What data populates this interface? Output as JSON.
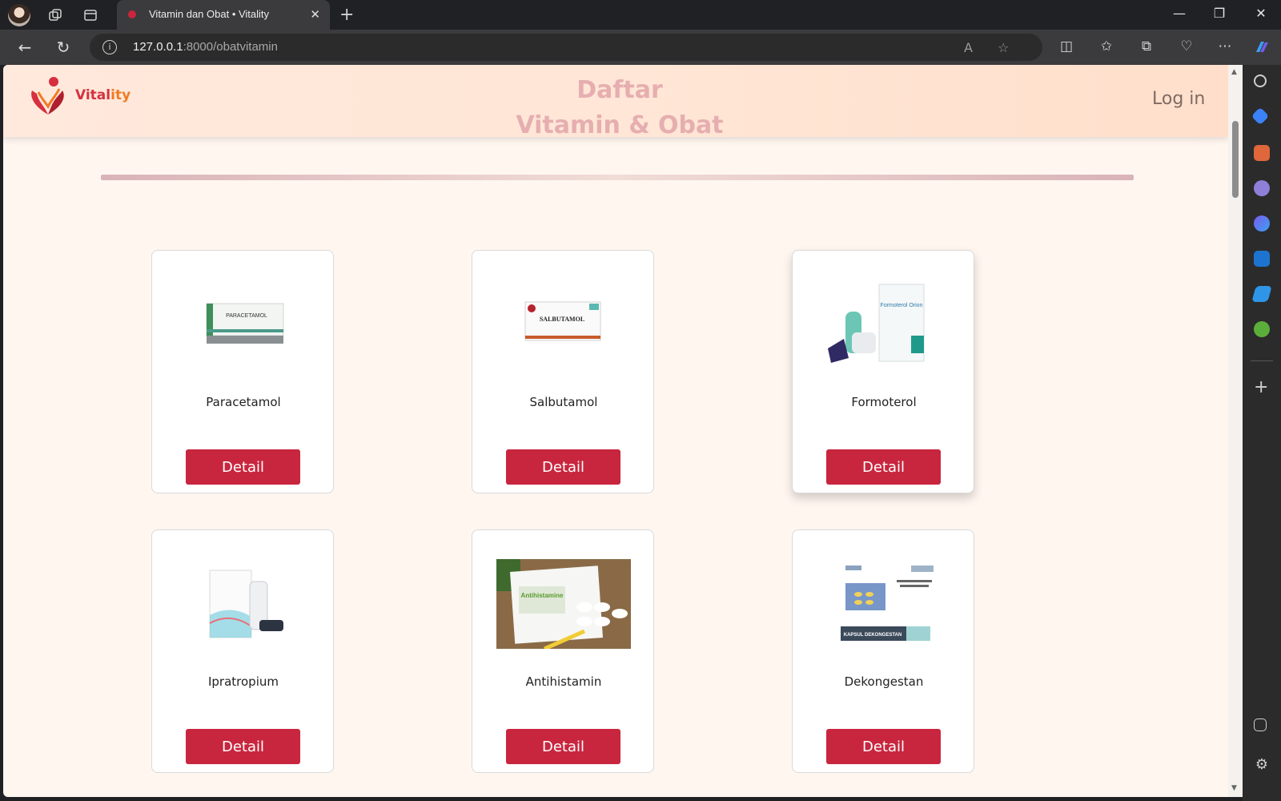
{
  "browser": {
    "tab_title": "Vitamin dan Obat • Vitality",
    "url_host": "127.0.0.1",
    "url_rest": ":8000/obatvitamin"
  },
  "site": {
    "logo": {
      "text_main": "Vital",
      "text_accent": "ity"
    },
    "heading_line1": "Daftar",
    "heading_line2": "Vitamin & Obat",
    "login_label": "Log in"
  },
  "products": [
    {
      "name": "Paracetamol",
      "button": "Detail",
      "package_text": "PARACETAMOL"
    },
    {
      "name": "Salbutamol",
      "button": "Detail",
      "package_text": "SALBUTAMOL"
    },
    {
      "name": "Formoterol",
      "button": "Detail",
      "package_text": "Formoterol Orion"
    },
    {
      "name": "Ipratropium",
      "button": "Detail",
      "package_text": ""
    },
    {
      "name": "Antihistamin",
      "button": "Detail",
      "package_text": "Antihistamine"
    },
    {
      "name": "Dekongestan",
      "button": "Detail",
      "package_text": "KAPSUL DEKONGESTAN"
    }
  ],
  "colors": {
    "brand_red": "#c8263e",
    "header_bg": "#ffe6d6",
    "page_bg": "#fff6f0",
    "heading": "#e6aeb0"
  }
}
